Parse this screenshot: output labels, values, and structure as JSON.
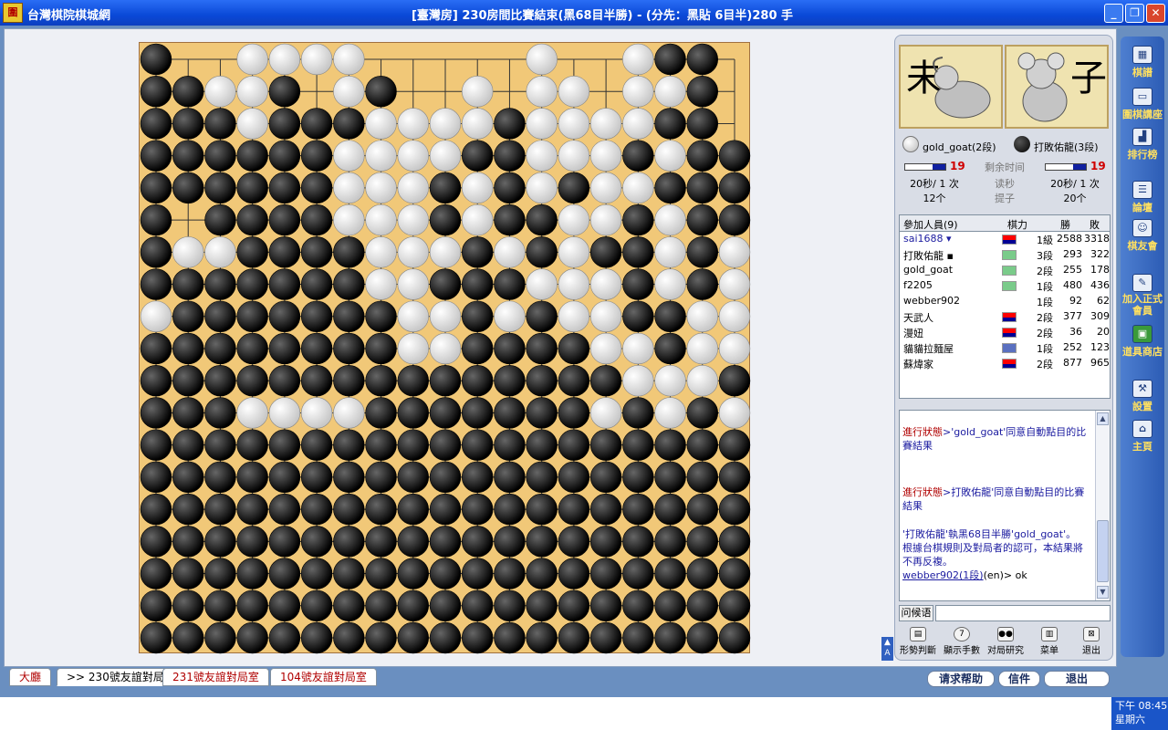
{
  "window": {
    "app_icon": "圍",
    "app_title": "台灣棋院棋城網",
    "title": "[臺灣房] 230房間比賽結束(黑68目半勝) - (分先：黑貼 6目半)280 手"
  },
  "board": {
    "size": 19,
    "rows": [
      "B..WWWW....W.WBB.",
      "BBBWBW.W.W..WWWB.",
      "BBBBBBW.WWBWWWWBW",
      "BBBBBBW.WWBBWWBBB",
      "BBBBBB.WBWBBWBWBB",
      "BB.B.BWWWBBWWWWBB",
      "BBBB.BBWBBWWWWWBB",
      "WBBB.BBWBBWWWWBWB",
      "BBBBBBWBB.BBBWWWB",
      "BBBBBBBWBWBBWBWB.",
      "BBBBBBBBBBBBWBWWW",
      "BBBBBBBBBBWBWBBWB",
      "BBBBBBBBBBBWWBWBB",
      "BBBBBBBBBWWBWWBBB",
      "BBBBBBBBBBBWWWWBB",
      "BBBBBBBBBBBBBBBWW",
      "BBBBBBBBBBBBBBBWB",
      "BBBBBBBBBBBBBBBBB",
      "BBBBBBBBBBBBBBBBB"
    ],
    "stones": [
      "B..WWWW.....W..WBB.",
      "BBWWB.WB..W.WW.WWB.",
      "BBBWBBBWWWWBWWWWBB.",
      "BBBBBBWWWWBBWWWBWBB",
      "BBBBBBWWWBWBWBWWBBB",
      "B.BBBBWWWBWBBWWBWBB",
      "BWWBBBBWWWBWBWBBWBW",
      "BBBBBBBWWBBBWWWBWBW",
      "WBBBBBBBWWBWBWWBBWW",
      "BBBBBBBBWWBBBBWWBWW",
      "BBBBBBBBBBBBBBBWWWB",
      "BBBWWWWBBBBBBBWBWBW",
      "BBBBBBBBBBBBBBBBBBB",
      "BBBBBBBBBBBBBBBBBBB",
      "BBBBBBBBBBBBBBBBBBB",
      "BBBBBBBBBBBBBBBBBBB",
      "BBBBBBBBBBBBBBBBBBB",
      "BBBBBBBBBBBBBBBBBBB",
      "BBBBBBBBBBBBBBBBBBB"
    ]
  },
  "players": {
    "white_name": "gold_goat(2段)",
    "black_name": "打敗佑龍(3段)",
    "white_zodiac": "未",
    "black_zodiac": "子"
  },
  "clock": {
    "white_periods": "19",
    "black_periods": "19",
    "white_byoyomi": "20秒/ 1 次",
    "black_byoyomi": "20秒/ 1 次",
    "white_captures": "12个",
    "black_captures": "20个",
    "label_remaining": "剩余时间",
    "label_byoyomi": "读秒",
    "label_captures": "提子"
  },
  "members": {
    "header": {
      "title": "參加人員(9)",
      "rank": "棋力",
      "wins": "勝",
      "losses": "敗"
    },
    "rows": [
      {
        "name": "sai1688 ▾",
        "rank": "1級",
        "wins": "2588",
        "losses": "3318",
        "flag": "tw",
        "blue": true
      },
      {
        "name": "打敗佑龍 ▪",
        "rank": "3段",
        "wins": "293",
        "losses": "322",
        "flag": "green"
      },
      {
        "name": "gold_goat",
        "rank": "2段",
        "wins": "255",
        "losses": "178",
        "flag": "green"
      },
      {
        "name": "f2205",
        "rank": "1段",
        "wins": "480",
        "losses": "436",
        "flag": "green"
      },
      {
        "name": "webber902",
        "rank": "1段",
        "wins": "92",
        "losses": "62",
        "flag": ""
      },
      {
        "name": "天武人",
        "rank": "2段",
        "wins": "377",
        "losses": "309",
        "flag": "tw"
      },
      {
        "name": "漫妞",
        "rank": "2段",
        "wins": "36",
        "losses": "20",
        "flag": "tw"
      },
      {
        "name": "貓貓拉麵屋",
        "rank": "1段",
        "wins": "252",
        "losses": "123",
        "flag": "other"
      },
      {
        "name": "蘇煒家",
        "rank": "2段",
        "wins": "877",
        "losses": "965",
        "flag": "tw"
      }
    ]
  },
  "chat": {
    "m1_status": "進行狀態",
    "m1_body": ">'gold_goat'同意自動點目的比賽結果",
    "m2_status": "進行狀態",
    "m2_body": ">打敗佑龍'同意自動點目的比賽結果",
    "m3_body": "'打敗佑龍'執黑68目半勝'gold_goat'。",
    "m4_body": "根據台棋規則及對局者的認可，本結果將不再反複。",
    "m5_user": "webber902(1段)",
    "m5_body": "(en)> ok",
    "greet": "问候语"
  },
  "tools": {
    "judge": "形勢判斷",
    "move_num": "顯示手數",
    "research": "对局研究",
    "menu": "菜单",
    "exit": "退出"
  },
  "sidebar": {
    "kifu": "棋譜",
    "lecture": "圍棋講座",
    "ranking": "排行榜",
    "forum": "論壇",
    "club": "棋友會",
    "join": "加入正式會員",
    "shop": "道具商店",
    "settings": "設置",
    "home": "主頁"
  },
  "tabs": {
    "lobby": "大廳",
    "room230": ">> 230號友誼對局室",
    "room231": "231號友誼對局室",
    "room104": "104號友誼對局室"
  },
  "buttons": {
    "help": "请求帮助",
    "mail": "信件",
    "quit": "退出"
  },
  "taskbar": {
    "time": "下午 08:45",
    "day": "星期六"
  },
  "colors": {
    "accent": "#0a49d7",
    "status_red": "#b00000",
    "link_blue": "#1c1ca0"
  }
}
